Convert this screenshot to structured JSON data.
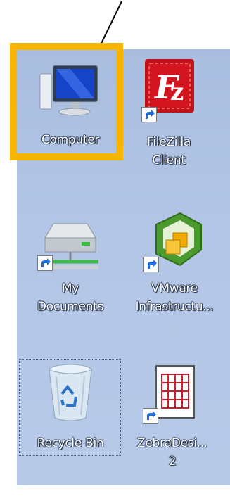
{
  "desktop": {
    "icons": [
      {
        "id": "computer",
        "label_lines": [
          "Computer"
        ],
        "icon": "computer-monitor-icon",
        "shortcut": false
      },
      {
        "id": "filezilla",
        "label_lines": [
          "FileZilla",
          "Client"
        ],
        "icon": "filezilla-icon",
        "shortcut": true
      },
      {
        "id": "my-documents",
        "label_lines": [
          "My",
          "Documents"
        ],
        "icon": "network-drive-icon",
        "shortcut": true
      },
      {
        "id": "vmware",
        "label_lines": [
          "VMware",
          "Infrastructu..."
        ],
        "icon": "vmware-icon",
        "shortcut": true
      },
      {
        "id": "recycle-bin",
        "label_lines": [
          "Recycle Bin"
        ],
        "icon": "recycle-bin-icon",
        "shortcut": false
      },
      {
        "id": "zebradesigner",
        "label_lines": [
          "ZebraDesi...",
          "2"
        ],
        "icon": "zebradesigner-icon",
        "shortcut": true
      }
    ]
  },
  "annotation": {
    "highlight_color": "#f7b500",
    "arrow_color": "#000000"
  }
}
